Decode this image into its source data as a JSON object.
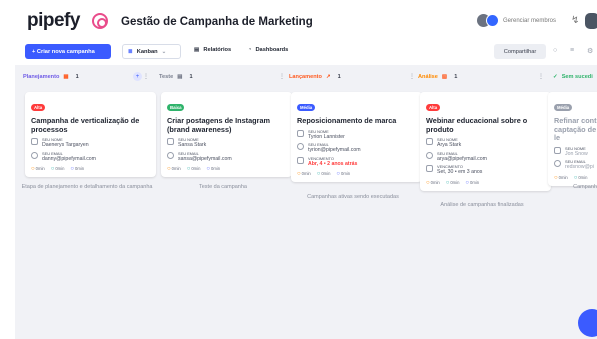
{
  "header": {
    "logo": "pipefy",
    "pipe_title": "Gestão de Campanha de Marketing",
    "manage_members": "Gerenciar membros"
  },
  "toolbar": {
    "new_campaign": "+ Criar nova campanha",
    "view": "Kanban",
    "reports": "Relatórios",
    "dashboards": "Dashboards",
    "share": "Compartilhar"
  },
  "colors": {
    "accent": "#3b5bff",
    "planning": "#6f5be6",
    "testing": "#7b8190",
    "launch": "#ff5a1f",
    "analysis": "#ff8a00",
    "success": "#2fb36b"
  },
  "columns": [
    {
      "name": "Planejamento",
      "count": "1",
      "card": {
        "badge": "Alta",
        "title": "Campanha de verticalização de processos",
        "name_label": "SEU NOME",
        "name": "Daenerys Targaryen",
        "email_label": "SEU EMAIL",
        "email": "danny@pipefymail.com",
        "footer": [
          "0min",
          "0min",
          "0min"
        ]
      },
      "description": "Etapa de planejamento e detalhamento da campanha"
    },
    {
      "name": "Teste",
      "count": "1",
      "card": {
        "badge": "Baixa",
        "title": "Criar postagens de Instagram (brand awareness)",
        "name_label": "SEU NOME",
        "name": "Sansa Stark",
        "email_label": "SEU EMAIL",
        "email": "sansa@pipefymail.com",
        "footer": [
          "0min",
          "0min",
          "0min"
        ]
      },
      "description": "Teste da campanha"
    },
    {
      "name": "Lançamento",
      "count": "1",
      "card": {
        "badge": "Média",
        "title": "Reposicionamento de marca",
        "name_label": "SEU NOME",
        "name": "Tyrion Lannister",
        "email_label": "SEU EMAIL",
        "email": "tyrion@pipefymail.com",
        "due_label": "VENCIMENTO",
        "due": "Abr, 4 • 2 anos atrás",
        "footer": [
          "0min",
          "0min",
          "0min"
        ]
      },
      "description": "Campanhas ativas sendo executadas"
    },
    {
      "name": "Análise",
      "count": "1",
      "card": {
        "badge": "Alta",
        "title": "Webinar educacional sobre o produto",
        "name_label": "SEU NOME",
        "name": "Arya Stark",
        "email_label": "SEU EMAIL",
        "email": "arya@pipefymail.com",
        "due_label": "VENCIMENTO",
        "due": "Set, 30 • em 3 anos",
        "footer": [
          "0min",
          "0min",
          "0min"
        ]
      },
      "description": "Análise de campanhas finalizadas"
    },
    {
      "name": "Sem sucedi",
      "card": {
        "badge": "Média",
        "title": "Refinar conte captação de le",
        "name_label": "SEU NOME",
        "name": "Jon Snow",
        "email_label": "SEU EMAIL",
        "email": "redsnow@pi",
        "footer": [
          "0min",
          "0min"
        ]
      },
      "description": "Campanh"
    }
  ]
}
